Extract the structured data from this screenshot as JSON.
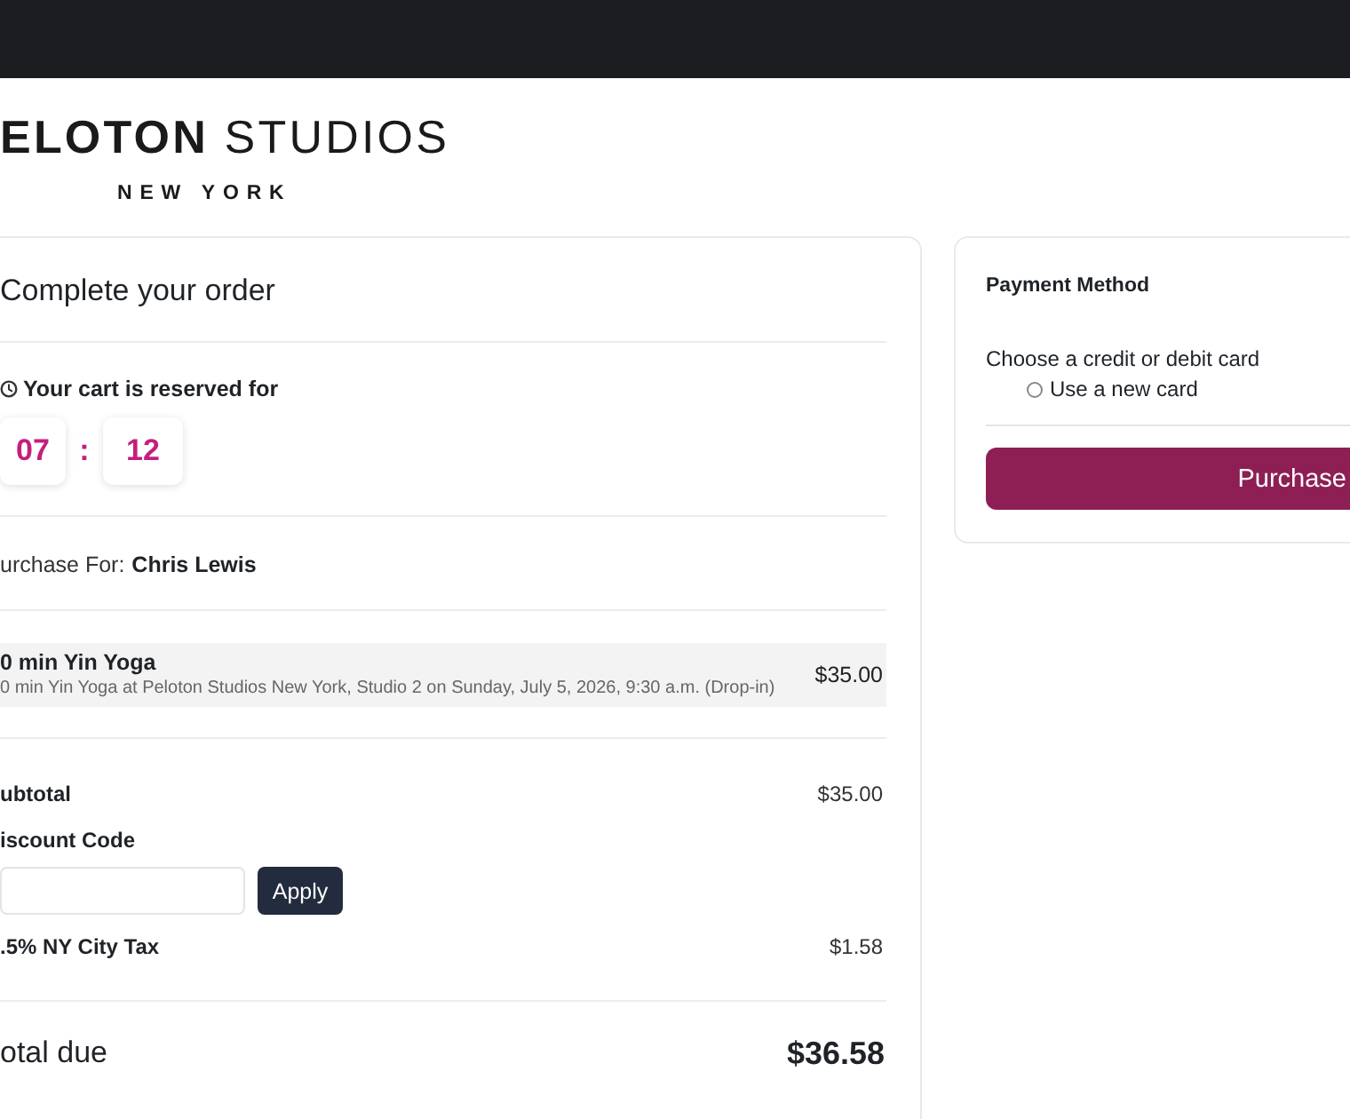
{
  "logo": {
    "brand": "ELOTON",
    "suffix": "STUDIOS",
    "location": "NEW YORK"
  },
  "order": {
    "title": "Complete your order",
    "reservation": {
      "label": "Your cart is reserved for",
      "minutes": "07",
      "separator": ":",
      "seconds": "12"
    },
    "purchase_for": {
      "label": "urchase For:",
      "name": "Chris Lewis"
    },
    "items": [
      {
        "title": "0 min Yin Yoga",
        "description": "0 min Yin Yoga at Peloton Studios New York, Studio 2 on Sunday, July 5, 2026, 9:30 a.m. (Drop-in)",
        "price": "$35.00"
      }
    ],
    "subtotal": {
      "label": "ubtotal",
      "value": "$35.00"
    },
    "discount": {
      "label": "iscount Code",
      "button": "Apply"
    },
    "tax": {
      "label": ".5% NY City Tax",
      "value": "$1.58"
    },
    "total": {
      "label": "otal due",
      "value": "$36.58"
    }
  },
  "payment": {
    "title": "Payment Method",
    "prompt": "Choose a credit or debit card",
    "options": [
      {
        "label": "Use a new card",
        "selected": false
      }
    ],
    "button": "Purchase"
  }
}
